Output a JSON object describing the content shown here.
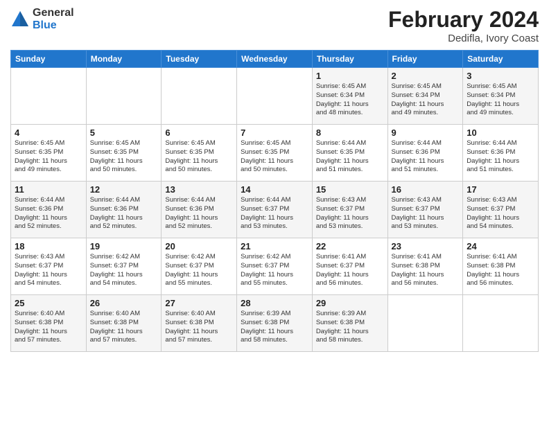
{
  "header": {
    "logo_general": "General",
    "logo_blue": "Blue",
    "month_title": "February 2024",
    "location": "Dedifla, Ivory Coast"
  },
  "days_of_week": [
    "Sunday",
    "Monday",
    "Tuesday",
    "Wednesday",
    "Thursday",
    "Friday",
    "Saturday"
  ],
  "weeks": [
    {
      "cells": [
        {
          "day": "",
          "info": ""
        },
        {
          "day": "",
          "info": ""
        },
        {
          "day": "",
          "info": ""
        },
        {
          "day": "",
          "info": ""
        },
        {
          "day": "1",
          "info": "Sunrise: 6:45 AM\nSunset: 6:34 PM\nDaylight: 11 hours\nand 48 minutes."
        },
        {
          "day": "2",
          "info": "Sunrise: 6:45 AM\nSunset: 6:34 PM\nDaylight: 11 hours\nand 49 minutes."
        },
        {
          "day": "3",
          "info": "Sunrise: 6:45 AM\nSunset: 6:34 PM\nDaylight: 11 hours\nand 49 minutes."
        }
      ]
    },
    {
      "cells": [
        {
          "day": "4",
          "info": "Sunrise: 6:45 AM\nSunset: 6:35 PM\nDaylight: 11 hours\nand 49 minutes."
        },
        {
          "day": "5",
          "info": "Sunrise: 6:45 AM\nSunset: 6:35 PM\nDaylight: 11 hours\nand 50 minutes."
        },
        {
          "day": "6",
          "info": "Sunrise: 6:45 AM\nSunset: 6:35 PM\nDaylight: 11 hours\nand 50 minutes."
        },
        {
          "day": "7",
          "info": "Sunrise: 6:45 AM\nSunset: 6:35 PM\nDaylight: 11 hours\nand 50 minutes."
        },
        {
          "day": "8",
          "info": "Sunrise: 6:44 AM\nSunset: 6:35 PM\nDaylight: 11 hours\nand 51 minutes."
        },
        {
          "day": "9",
          "info": "Sunrise: 6:44 AM\nSunset: 6:36 PM\nDaylight: 11 hours\nand 51 minutes."
        },
        {
          "day": "10",
          "info": "Sunrise: 6:44 AM\nSunset: 6:36 PM\nDaylight: 11 hours\nand 51 minutes."
        }
      ]
    },
    {
      "cells": [
        {
          "day": "11",
          "info": "Sunrise: 6:44 AM\nSunset: 6:36 PM\nDaylight: 11 hours\nand 52 minutes."
        },
        {
          "day": "12",
          "info": "Sunrise: 6:44 AM\nSunset: 6:36 PM\nDaylight: 11 hours\nand 52 minutes."
        },
        {
          "day": "13",
          "info": "Sunrise: 6:44 AM\nSunset: 6:36 PM\nDaylight: 11 hours\nand 52 minutes."
        },
        {
          "day": "14",
          "info": "Sunrise: 6:44 AM\nSunset: 6:37 PM\nDaylight: 11 hours\nand 53 minutes."
        },
        {
          "day": "15",
          "info": "Sunrise: 6:43 AM\nSunset: 6:37 PM\nDaylight: 11 hours\nand 53 minutes."
        },
        {
          "day": "16",
          "info": "Sunrise: 6:43 AM\nSunset: 6:37 PM\nDaylight: 11 hours\nand 53 minutes."
        },
        {
          "day": "17",
          "info": "Sunrise: 6:43 AM\nSunset: 6:37 PM\nDaylight: 11 hours\nand 54 minutes."
        }
      ]
    },
    {
      "cells": [
        {
          "day": "18",
          "info": "Sunrise: 6:43 AM\nSunset: 6:37 PM\nDaylight: 11 hours\nand 54 minutes."
        },
        {
          "day": "19",
          "info": "Sunrise: 6:42 AM\nSunset: 6:37 PM\nDaylight: 11 hours\nand 54 minutes."
        },
        {
          "day": "20",
          "info": "Sunrise: 6:42 AM\nSunset: 6:37 PM\nDaylight: 11 hours\nand 55 minutes."
        },
        {
          "day": "21",
          "info": "Sunrise: 6:42 AM\nSunset: 6:37 PM\nDaylight: 11 hours\nand 55 minutes."
        },
        {
          "day": "22",
          "info": "Sunrise: 6:41 AM\nSunset: 6:37 PM\nDaylight: 11 hours\nand 56 minutes."
        },
        {
          "day": "23",
          "info": "Sunrise: 6:41 AM\nSunset: 6:38 PM\nDaylight: 11 hours\nand 56 minutes."
        },
        {
          "day": "24",
          "info": "Sunrise: 6:41 AM\nSunset: 6:38 PM\nDaylight: 11 hours\nand 56 minutes."
        }
      ]
    },
    {
      "cells": [
        {
          "day": "25",
          "info": "Sunrise: 6:40 AM\nSunset: 6:38 PM\nDaylight: 11 hours\nand 57 minutes."
        },
        {
          "day": "26",
          "info": "Sunrise: 6:40 AM\nSunset: 6:38 PM\nDaylight: 11 hours\nand 57 minutes."
        },
        {
          "day": "27",
          "info": "Sunrise: 6:40 AM\nSunset: 6:38 PM\nDaylight: 11 hours\nand 57 minutes."
        },
        {
          "day": "28",
          "info": "Sunrise: 6:39 AM\nSunset: 6:38 PM\nDaylight: 11 hours\nand 58 minutes."
        },
        {
          "day": "29",
          "info": "Sunrise: 6:39 AM\nSunset: 6:38 PM\nDaylight: 11 hours\nand 58 minutes."
        },
        {
          "day": "",
          "info": ""
        },
        {
          "day": "",
          "info": ""
        }
      ]
    }
  ]
}
